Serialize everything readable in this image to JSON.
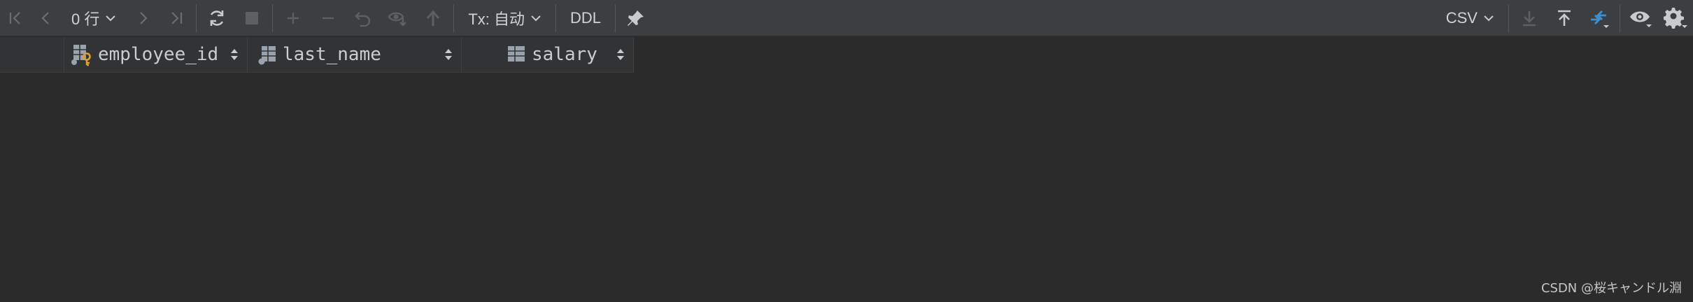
{
  "toolbar": {
    "row_count": "0 行",
    "tx_label": "Tx: 自动",
    "ddl_label": "DDL",
    "export_format": "CSV"
  },
  "columns": [
    {
      "name": "employee_id",
      "icon": "primary-key-column-icon"
    },
    {
      "name": "last_name",
      "icon": "table-column-icon"
    },
    {
      "name": "salary",
      "icon": "table-column-icon"
    }
  ],
  "rows": [],
  "colors": {
    "toolbar_bg": "#3c3f41",
    "grid_bg": "#2b2b2b",
    "header_bg": "#313335",
    "accent_blue": "#3d8fd1",
    "key_orange": "#e0a030"
  },
  "watermark": "CSDN @桜キャンドル淵"
}
